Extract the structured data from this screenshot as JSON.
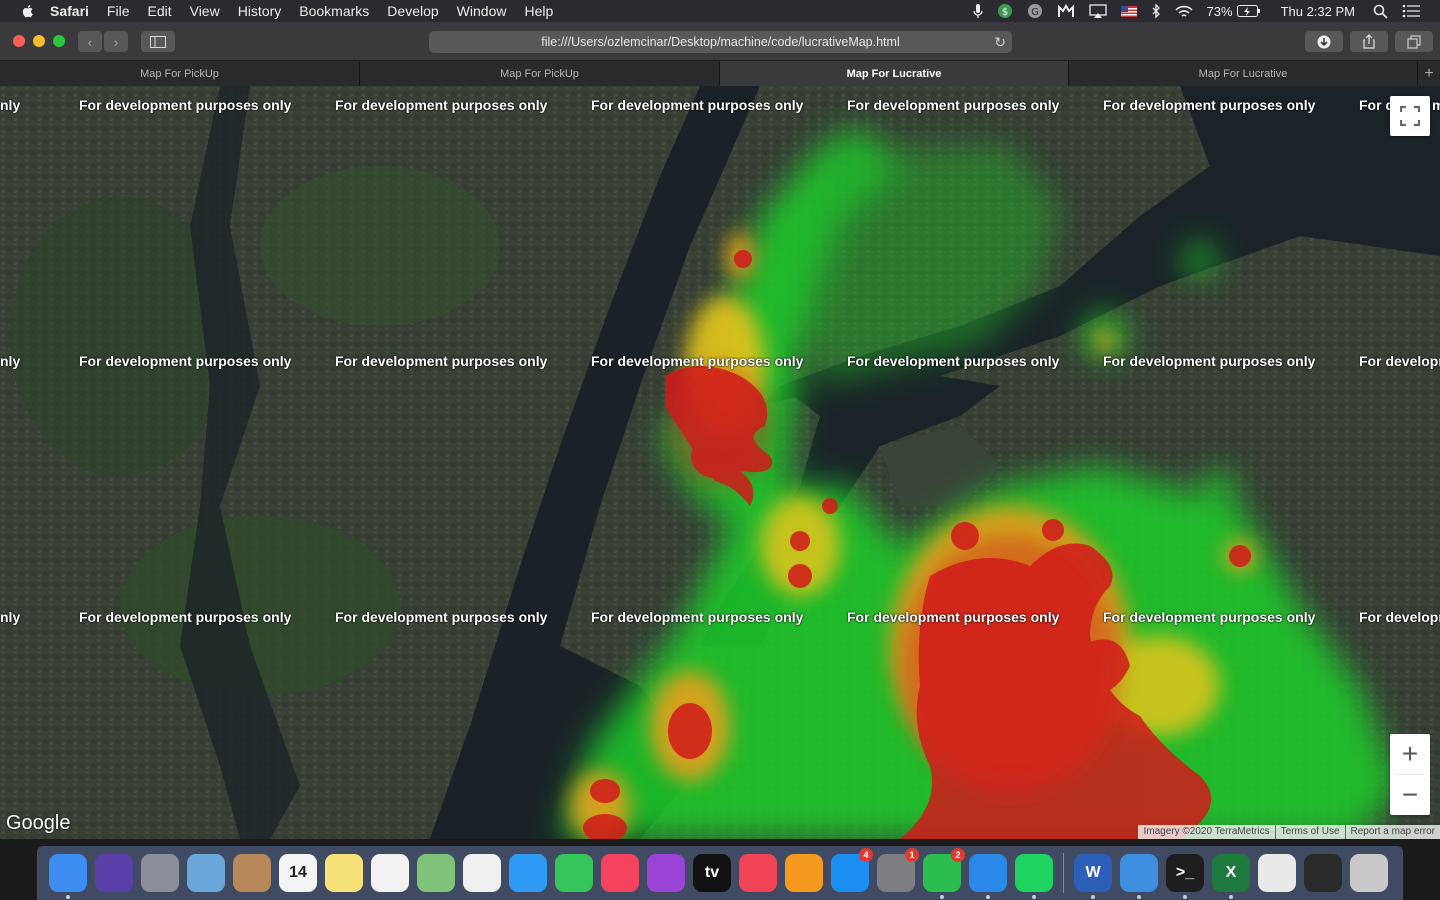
{
  "menubar": {
    "app_name": "Safari",
    "items": [
      "File",
      "Edit",
      "View",
      "History",
      "Bookmarks",
      "Develop",
      "Window",
      "Help"
    ],
    "battery": "73%",
    "clock": "Thu 2:32 PM"
  },
  "toolbar": {
    "url": "file:///Users/ozlemcinar/Desktop/machine/code/lucrativeMap.html"
  },
  "tabs": [
    {
      "label": "Map For PickUp",
      "active": false
    },
    {
      "label": "Map For PickUp",
      "active": false
    },
    {
      "label": "Map For Lucrative",
      "active": true
    },
    {
      "label": "Map For Lucrative",
      "active": false
    }
  ],
  "map": {
    "watermark": "For development purposes only",
    "watermark_fragments": {
      "left_edge": "nly",
      "right_top": "For d",
      "right_top_tail": "m",
      "right_row": "For developm"
    },
    "google_logo": "Google",
    "attribution": [
      "Imagery ©2020 TerraMetrics",
      "Terms of Use",
      "Report a map error"
    ],
    "zoom_in": "+",
    "zoom_out": "−"
  },
  "dock": {
    "apps": [
      {
        "name": "Finder",
        "icon": "finder-icon",
        "color": "#3d8ef0"
      },
      {
        "name": "Siri",
        "icon": "siri-icon",
        "color": "#5b3fa8"
      },
      {
        "name": "Launchpad",
        "icon": "launchpad-icon",
        "color": "#8a8f9a"
      },
      {
        "name": "Mail",
        "icon": "mail-icon",
        "color": "#6aa7d8"
      },
      {
        "name": "Contacts",
        "icon": "contacts-icon",
        "color": "#b7895a"
      },
      {
        "name": "Calendar",
        "icon": "calendar-icon",
        "color": "#f4f4f4",
        "text": "14",
        "subtext": "MAY"
      },
      {
        "name": "Notes",
        "icon": "notes-icon",
        "color": "#f7e27a"
      },
      {
        "name": "Reminders",
        "icon": "reminders-icon",
        "color": "#f2f2f2"
      },
      {
        "name": "Maps",
        "icon": "maps-icon",
        "color": "#7fc37a"
      },
      {
        "name": "Photos",
        "icon": "photos-icon",
        "color": "#f0f0f0"
      },
      {
        "name": "Messages",
        "icon": "messages-icon",
        "color": "#2f9bf5"
      },
      {
        "name": "FaceTime",
        "icon": "facetime-icon",
        "color": "#36c55a"
      },
      {
        "name": "Music",
        "icon": "music-icon",
        "color": "#f5435f"
      },
      {
        "name": "Podcasts",
        "icon": "podcasts-icon",
        "color": "#9a44d6"
      },
      {
        "name": "TV",
        "icon": "tv-icon",
        "color": "#111111",
        "text": "tv"
      },
      {
        "name": "News",
        "icon": "news-icon",
        "color": "#f04455"
      },
      {
        "name": "Books",
        "icon": "books-icon",
        "color": "#f59a1e"
      },
      {
        "name": "App Store",
        "icon": "app-store-icon",
        "color": "#1b8ef2",
        "badge": "4"
      },
      {
        "name": "System Preferences",
        "icon": "system-preferences-icon",
        "color": "#7d7d82",
        "badge": "1"
      },
      {
        "name": "WhatsApp",
        "icon": "whatsapp-icon",
        "color": "#2bbd4e",
        "badge": "2"
      },
      {
        "name": "Safari",
        "icon": "safari-icon",
        "color": "#2a88e8"
      },
      {
        "name": "Spotify",
        "icon": "spotify-icon",
        "color": "#1ed35f"
      }
    ],
    "apps_right": [
      {
        "name": "Word",
        "icon": "word-icon",
        "color": "#2b5fb8",
        "text": "W"
      },
      {
        "name": "Xcode",
        "icon": "xcode-icon",
        "color": "#3f8fe0"
      },
      {
        "name": "Terminal",
        "icon": "terminal-icon",
        "color": "#1e1e1e",
        "text": ">_"
      },
      {
        "name": "Excel",
        "icon": "excel-icon",
        "color": "#1e7a3f",
        "text": "X"
      },
      {
        "name": "Document",
        "icon": "document-icon",
        "color": "#e9e9e9"
      },
      {
        "name": "Screenshot",
        "icon": "screenshot-icon",
        "color": "#2a2a2a"
      },
      {
        "name": "Trash",
        "icon": "trash-icon",
        "color": "#c9c9c9"
      }
    ]
  }
}
